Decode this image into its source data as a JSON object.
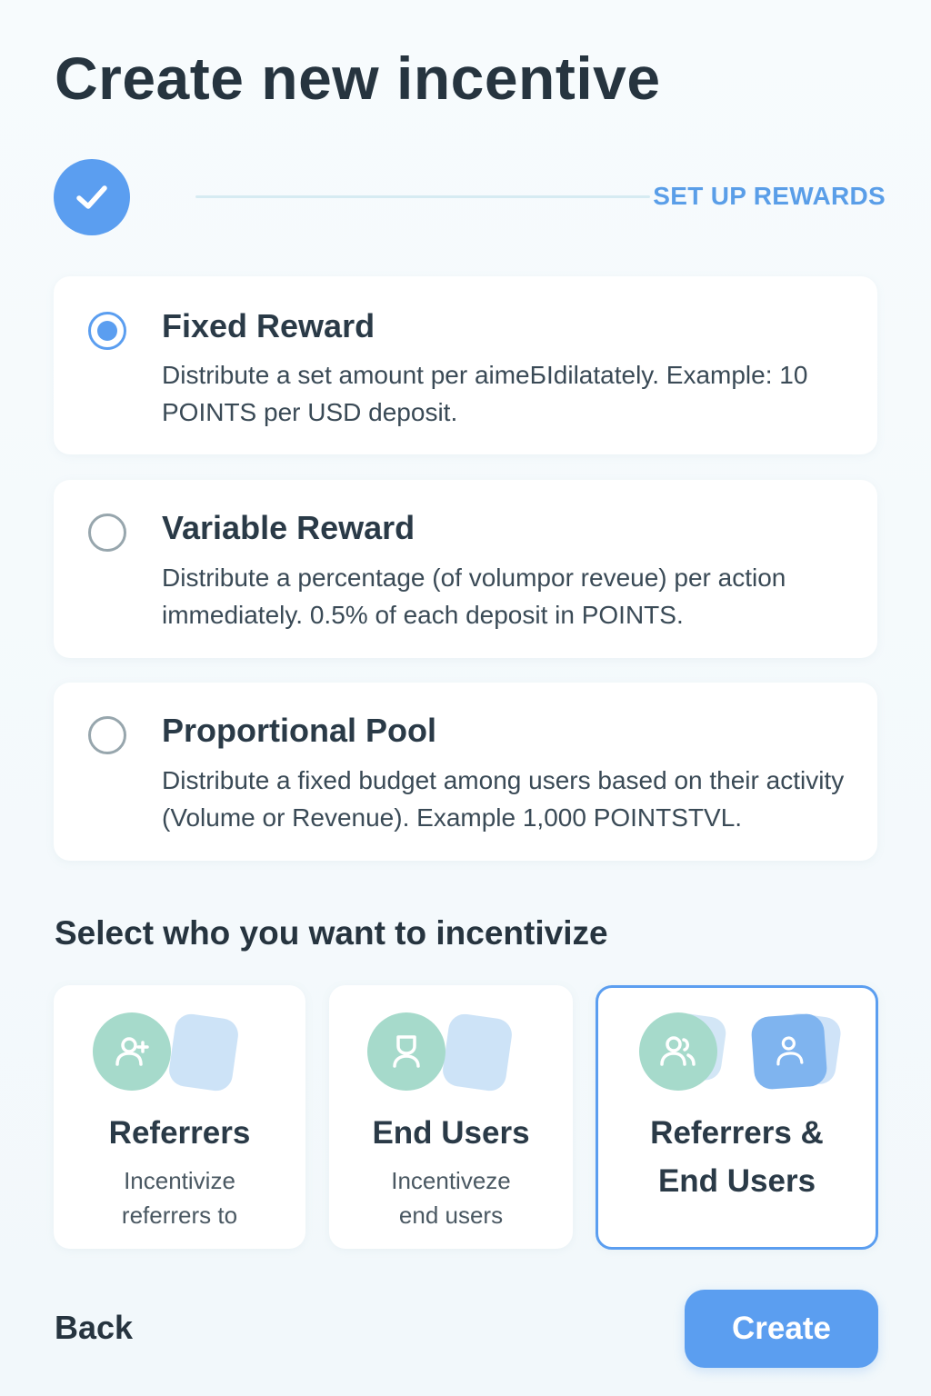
{
  "page": {
    "title": "Create new incentive"
  },
  "stepper": {
    "current_step_label": "SET UP REWARDS"
  },
  "reward_options": [
    {
      "title": "Fixed Reward",
      "description": "Distribute a set amount per aimeБІdilatately. Example: 10 POINTS per USD deposit.",
      "selected": true
    },
    {
      "title": "Variable Reward",
      "description": "Distribute a percentage (of volumpor reveue) per action immediately. 0.5% of each deposit in POINTS.",
      "selected": false
    },
    {
      "title": "Proportional Pool",
      "description": "Distribute a fixed budget among users based on their activity (Volume or Revenue). Example 1,000 POINTSTVL.",
      "selected": false
    }
  ],
  "audience": {
    "section_title": "Select who you want to incentivize",
    "options": [
      {
        "title": "Referrers",
        "description_line1": "Incentivize",
        "description_line2": "referrers to",
        "icon": "user-plus-icon",
        "selected": false
      },
      {
        "title": "End Users",
        "description_line1": "Incentiveze",
        "description_line2": "end users",
        "icon": "user-icon",
        "selected": false
      },
      {
        "title_line1": "Referrers &",
        "title_line2": "End Users",
        "icon": "users-icon",
        "icon_secondary": "user-badge-icon",
        "selected": true
      }
    ]
  },
  "footer": {
    "back_label": "Back",
    "create_label": "Create"
  },
  "colors": {
    "accent": "#5b9ef0",
    "icon_teal": "#a6dacb",
    "text_dark": "#26343f"
  }
}
